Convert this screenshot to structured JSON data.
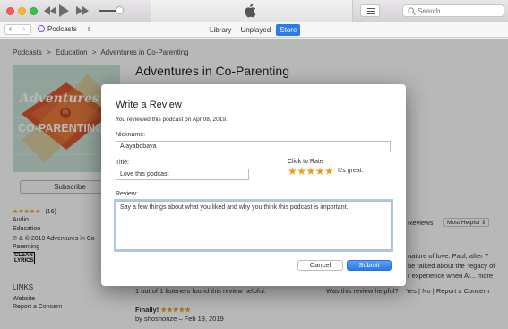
{
  "toolbar": {
    "back_icon": "rewind-icon",
    "play_icon": "play-icon",
    "forward_icon": "fast-forward-icon",
    "search_placeholder": "Search"
  },
  "nav": {
    "media_label": "Podcasts",
    "tabs": [
      {
        "label": "Library",
        "active": false
      },
      {
        "label": "Unplayed",
        "active": false
      },
      {
        "label": "Store",
        "active": true
      }
    ]
  },
  "breadcrumb": {
    "items": [
      "Podcasts",
      "Education",
      "Adventures in Co-Parenting"
    ],
    "separator": ">"
  },
  "podcast": {
    "title": "Adventures in Co-Parenting",
    "artwork_word1": "Adventures",
    "artwork_word2": "in",
    "artwork_word3": "CO-PARENTING",
    "subscribe_label": "Subscribe",
    "rating_stars": "★★★★★",
    "rating_count": "(16)",
    "format": "Audio",
    "genre": "Education",
    "copyright": "℗ & © 2019 Adventures in Co-Parenting",
    "explicit_badge": "CLEAN\nLYRICS"
  },
  "links": {
    "heading": "LINKS",
    "items": [
      "Website",
      "Report a Concern"
    ]
  },
  "reviews_bg": {
    "heading_fragment": "Reviews",
    "sort_label": "Most Helpful",
    "fragment1": "nature of love. Paul, after 7",
    "fragment2": "be talked about the 'legacy of",
    "fragment3": "r experience when Al... more",
    "helpful_count": "1 out of 1 listeners found this review helpful.",
    "helpful_question": "Was this review helpful?",
    "yes": "Yes",
    "no": "No",
    "report": "Report a Concern",
    "next_title": "Finally!",
    "next_stars": "★★★★★",
    "next_author": "by shoshonze – Feb 18, 2019"
  },
  "modal": {
    "title": "Write a Review",
    "reviewed_text": "You reviewed this podcast on Apr 08, 2019.",
    "nickname_label": "Nickname:",
    "nickname_value": "Alayabobaya",
    "title_label": "Title:",
    "title_value": "Love this podcast",
    "rate_label": "Click to Rate",
    "rate_stars": "★★★★★",
    "rating": 5,
    "rate_text": "It's great.",
    "review_label": "Review:",
    "review_value": "Say a few things about what you liked and why you think this podcast is important.",
    "cancel_label": "Cancel",
    "submit_label": "Submit"
  },
  "colors": {
    "accent": "#2b7be8",
    "stars": "#f29a1f"
  }
}
